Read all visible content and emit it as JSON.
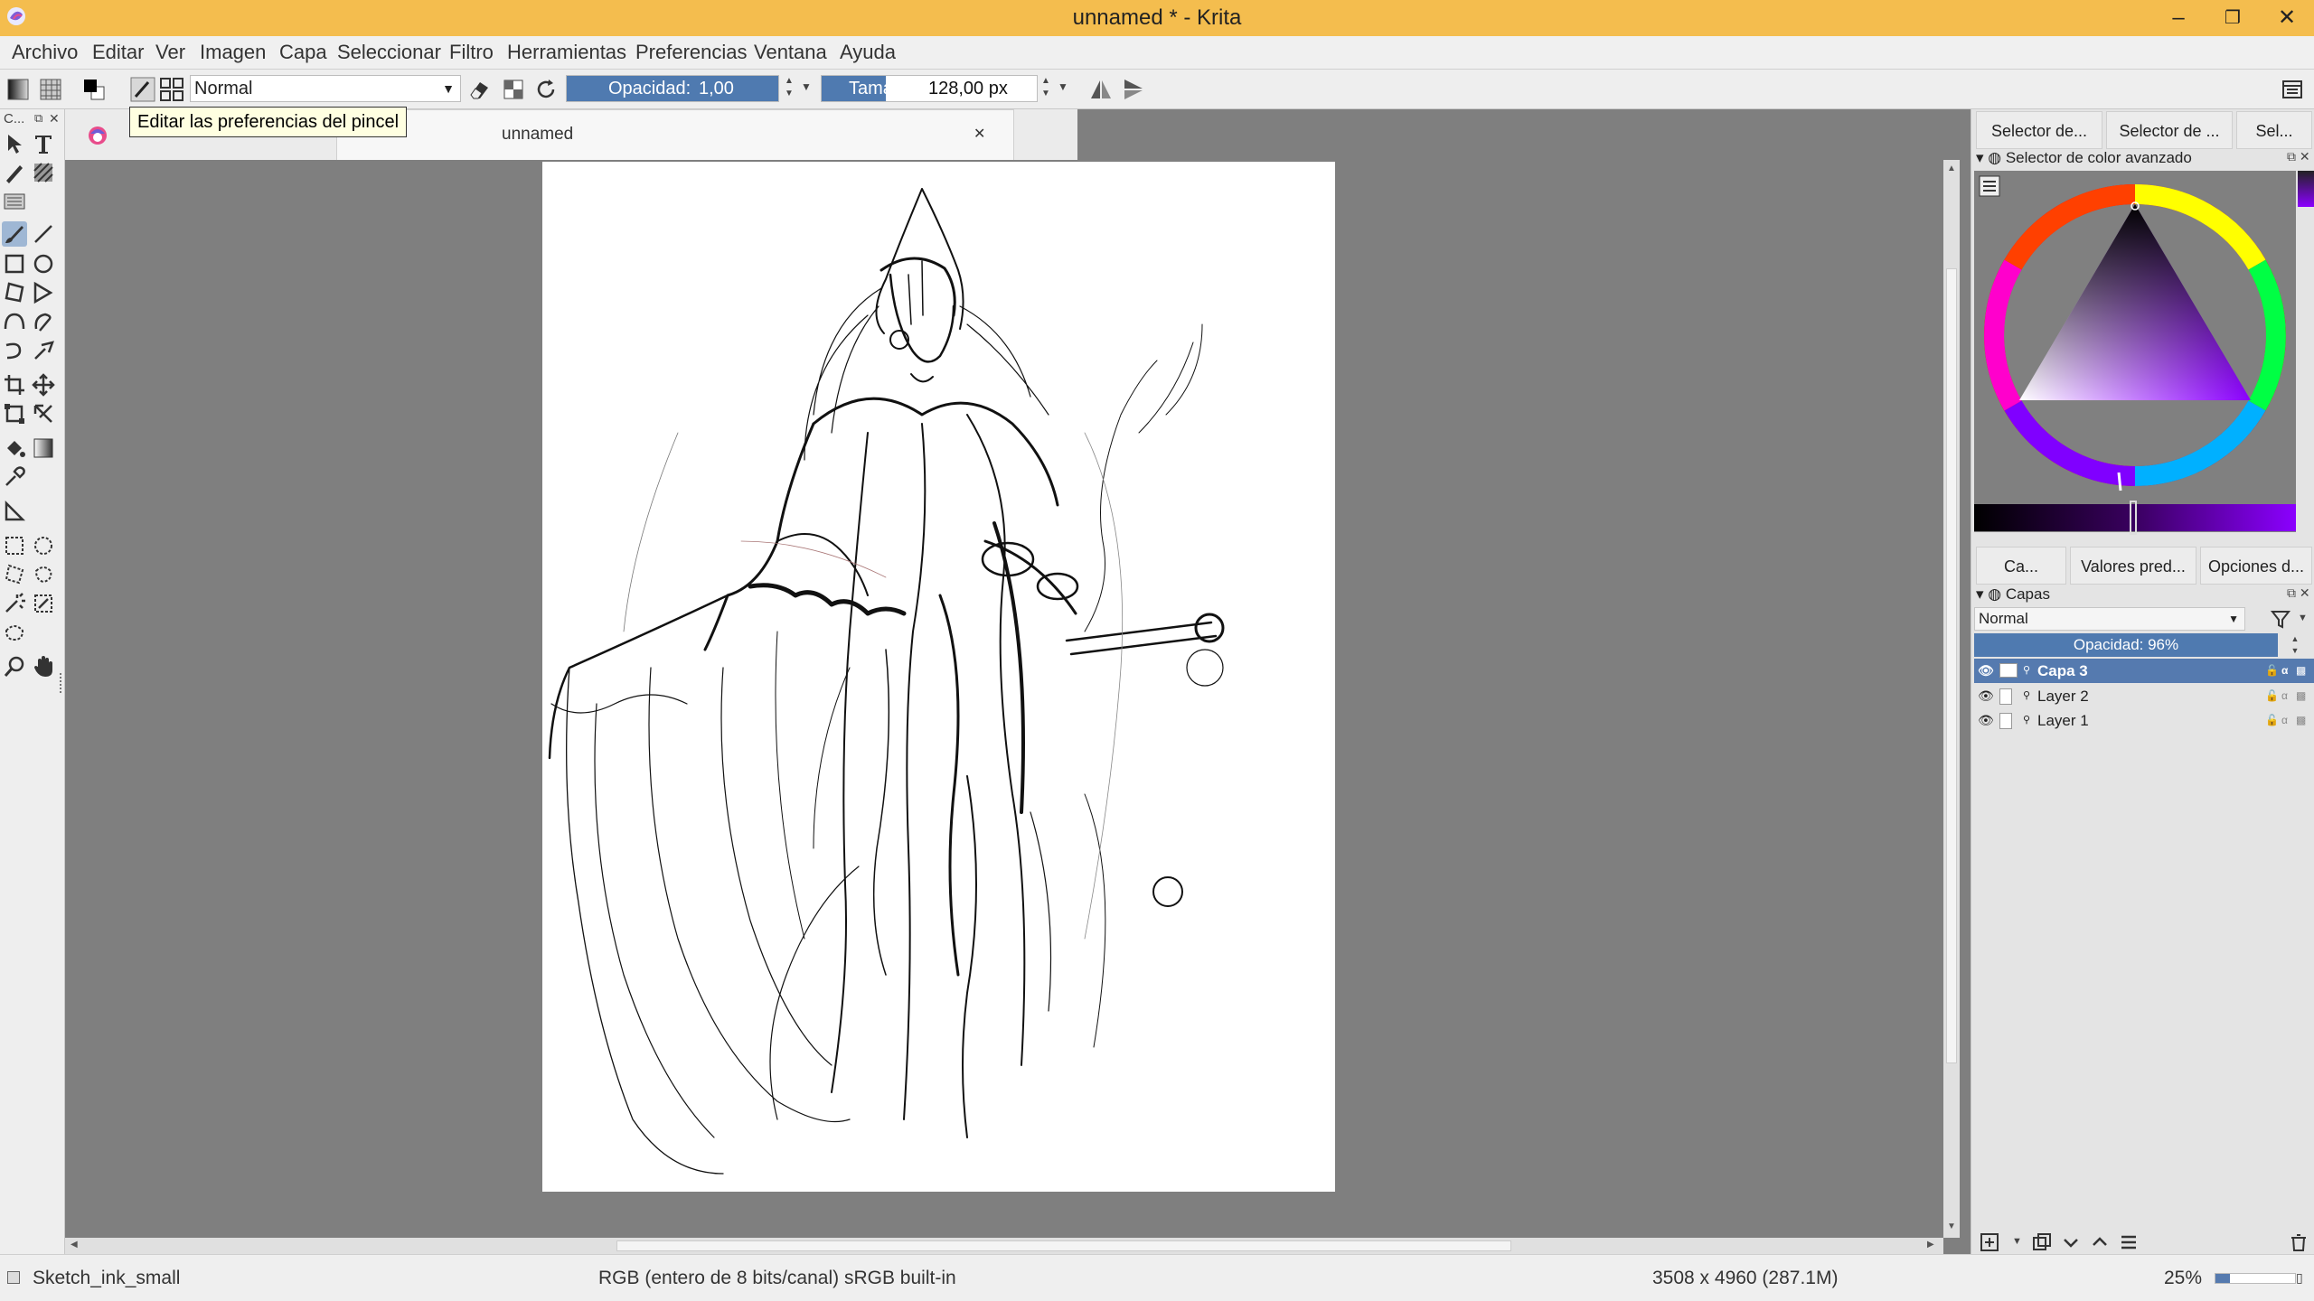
{
  "window": {
    "title": "unnamed * - Krita",
    "controls": {
      "minimize": "–",
      "maximize": "❐",
      "close": "✕"
    }
  },
  "menu": [
    "Archivo",
    "Editar",
    "Ver",
    "Imagen",
    "Capa",
    "Seleccionar",
    "Filtro",
    "Herramientas",
    "Preferencias",
    "Ventana",
    "Ayuda"
  ],
  "tool_options": {
    "blend_mode": "Normal",
    "opacity_label": "Opacidad:",
    "opacity_value": "1,00",
    "size_label": "Tamaño:",
    "size_value": "128,00 px"
  },
  "tooltip": "Editar las preferencias del pincel",
  "toolbox_header": "C...",
  "document_tab": {
    "label": "unnamed",
    "close": "✕"
  },
  "docker_tabs_top": [
    "Selector de...",
    "Selector de ...",
    "Sel..."
  ],
  "color_selector": {
    "title": "Selector de color avanzado"
  },
  "docker_tabs_mid": [
    "Ca...",
    "Valores pred...",
    "Opciones d..."
  ],
  "layers": {
    "title": "Capas",
    "blend_mode": "Normal",
    "opacity_text": "Opacidad:  96%",
    "items": [
      {
        "name": "Capa 3",
        "selected": true
      },
      {
        "name": "Layer 2",
        "selected": false
      },
      {
        "name": "Layer 1",
        "selected": false
      }
    ]
  },
  "status": {
    "brush_preset": "Sketch_ink_small",
    "color_space": "RGB (entero de 8 bits/canal)  sRGB built-in",
    "dimensions": "3508 x 4960 (287.1M)",
    "zoom": "25%"
  },
  "colors": {
    "titlebar": "#f4bd4e",
    "selection": "#557aaf",
    "slider_fill": "#4f7ab0",
    "canvas_bg": "#7f7f7f"
  }
}
